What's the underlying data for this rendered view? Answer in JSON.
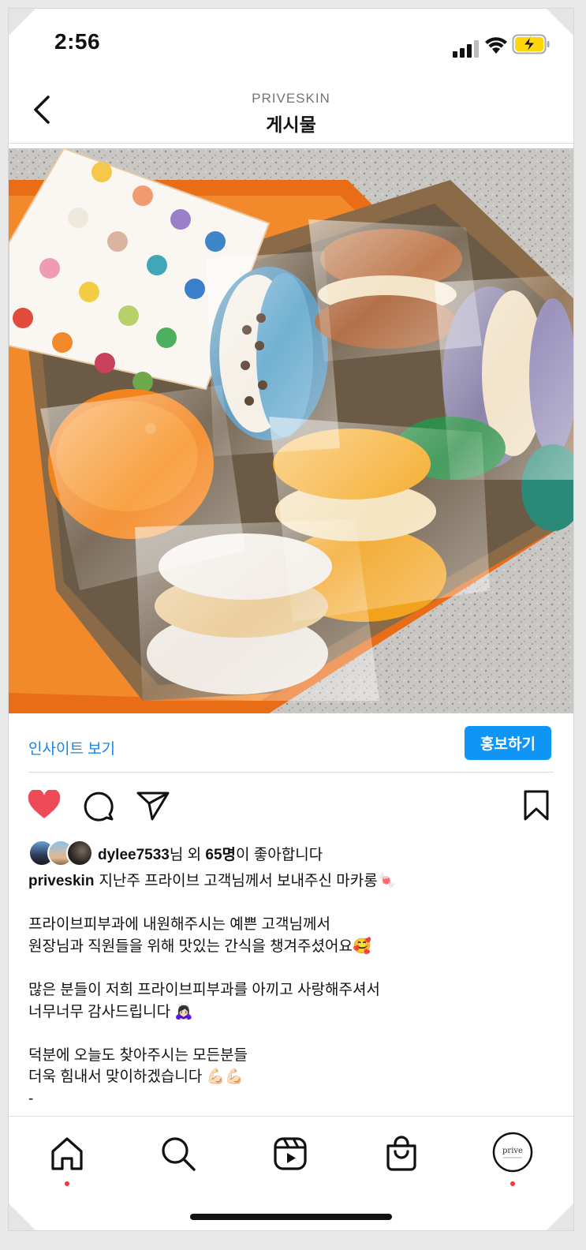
{
  "status_bar": {
    "time": "2:56"
  },
  "header": {
    "account": "PRIVESKIN",
    "title": "게시물"
  },
  "insight": {
    "link_label": "인사이트 보기",
    "promote_label": "홍보하기"
  },
  "likes": {
    "username": "dylee7533",
    "text_mid": "님 외 ",
    "count": "65명",
    "text_end": "이 좋아합니다"
  },
  "caption": {
    "username": "priveskin",
    "first_line": "지난주 프라이브 고객님께서 보내주신 마카롱🍬",
    "line2": "",
    "line3": "프라이브피부과에 내원해주시는 예쁜 고객님께서",
    "line4": "원장님과 직원들을 위해 맛있는 간식을 챙겨주셨어요🥰",
    "line5": "",
    "line6": "많은 분들이 저희 프라이브피부과를 아끼고 사랑해주셔서",
    "line7": "너무너무 감사드립니다 🙇🏻‍♀️",
    "line8": "",
    "line9": "덕분에 오늘도 찾아주시는 모든분들",
    "line10": "더욱 힘내서 맞이하겠습니다 💪🏻💪🏻",
    "line11": "-"
  },
  "profile_nav": {
    "avatar_text": "prive"
  },
  "colors": {
    "accent": "#0f95f6",
    "link": "#1785e6",
    "like": "#ed4956",
    "notification": "#ff3040"
  },
  "icons": [
    "back-chevron-icon",
    "heart-icon",
    "comment-icon",
    "share-icon",
    "bookmark-icon",
    "home-icon",
    "search-icon",
    "reels-icon",
    "shop-icon",
    "profile-icon"
  ]
}
